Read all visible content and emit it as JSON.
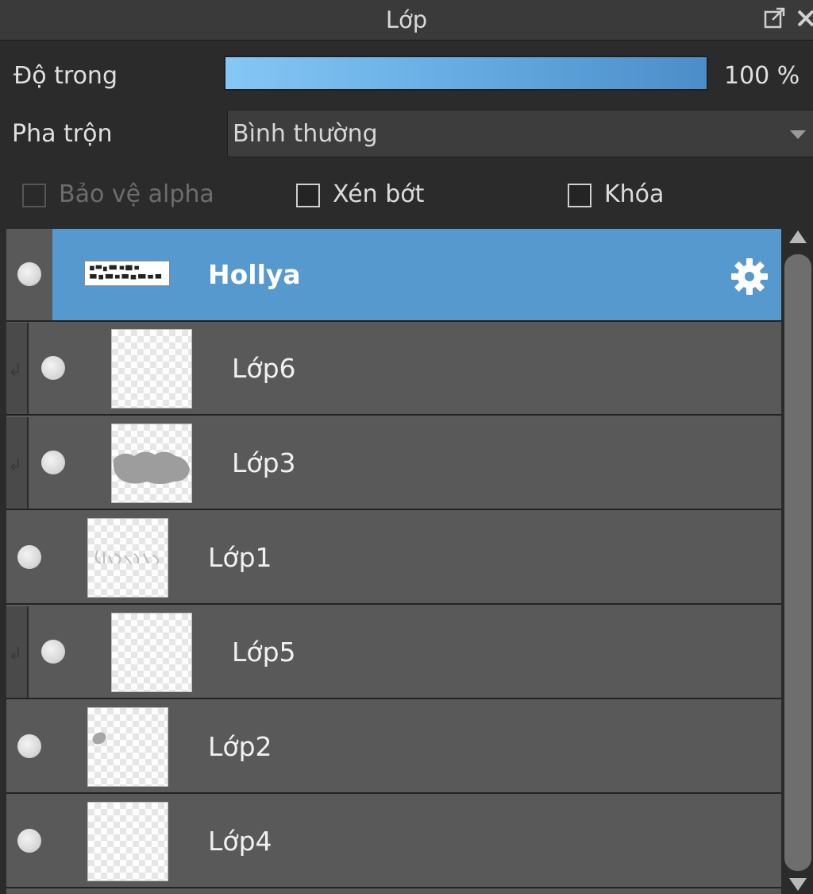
{
  "panel": {
    "title": "Lớp",
    "popout_icon": "popout-icon",
    "close_icon": "close-icon"
  },
  "opacity": {
    "label": "Độ trong",
    "value": 100,
    "value_text": "100 %",
    "fill_color_start": "#85c7f5",
    "fill_color_end": "#4b8dc8"
  },
  "blend": {
    "label": "Pha trộn",
    "selected": "Bình thường"
  },
  "options": {
    "alpha_protect": {
      "label": "Bảo vệ alpha",
      "checked": false,
      "enabled": false
    },
    "clipping": {
      "label": "Xén bớt",
      "checked": false,
      "enabled": true
    },
    "lock": {
      "label": "Khóa",
      "checked": false,
      "enabled": true
    }
  },
  "layers": [
    {
      "name": "Hollya",
      "selected": true,
      "clipped": false,
      "thumb": "text",
      "settings_icon": "gear-icon"
    },
    {
      "name": "Lớp6",
      "selected": false,
      "clipped": true,
      "thumb": "empty"
    },
    {
      "name": "Lớp3",
      "selected": false,
      "clipped": true,
      "thumb": "cloud"
    },
    {
      "name": "Lớp1",
      "selected": false,
      "clipped": false,
      "thumb": "sketch"
    },
    {
      "name": "Lớp5",
      "selected": false,
      "clipped": true,
      "thumb": "empty"
    },
    {
      "name": "Lớp2",
      "selected": false,
      "clipped": false,
      "thumb": "dot"
    },
    {
      "name": "Lớp4",
      "selected": false,
      "clipped": false,
      "thumb": "empty"
    }
  ],
  "colors": {
    "selected_layer": "#5699cf",
    "layer_bg": "#595959",
    "panel_bg": "#2b2b2b"
  }
}
